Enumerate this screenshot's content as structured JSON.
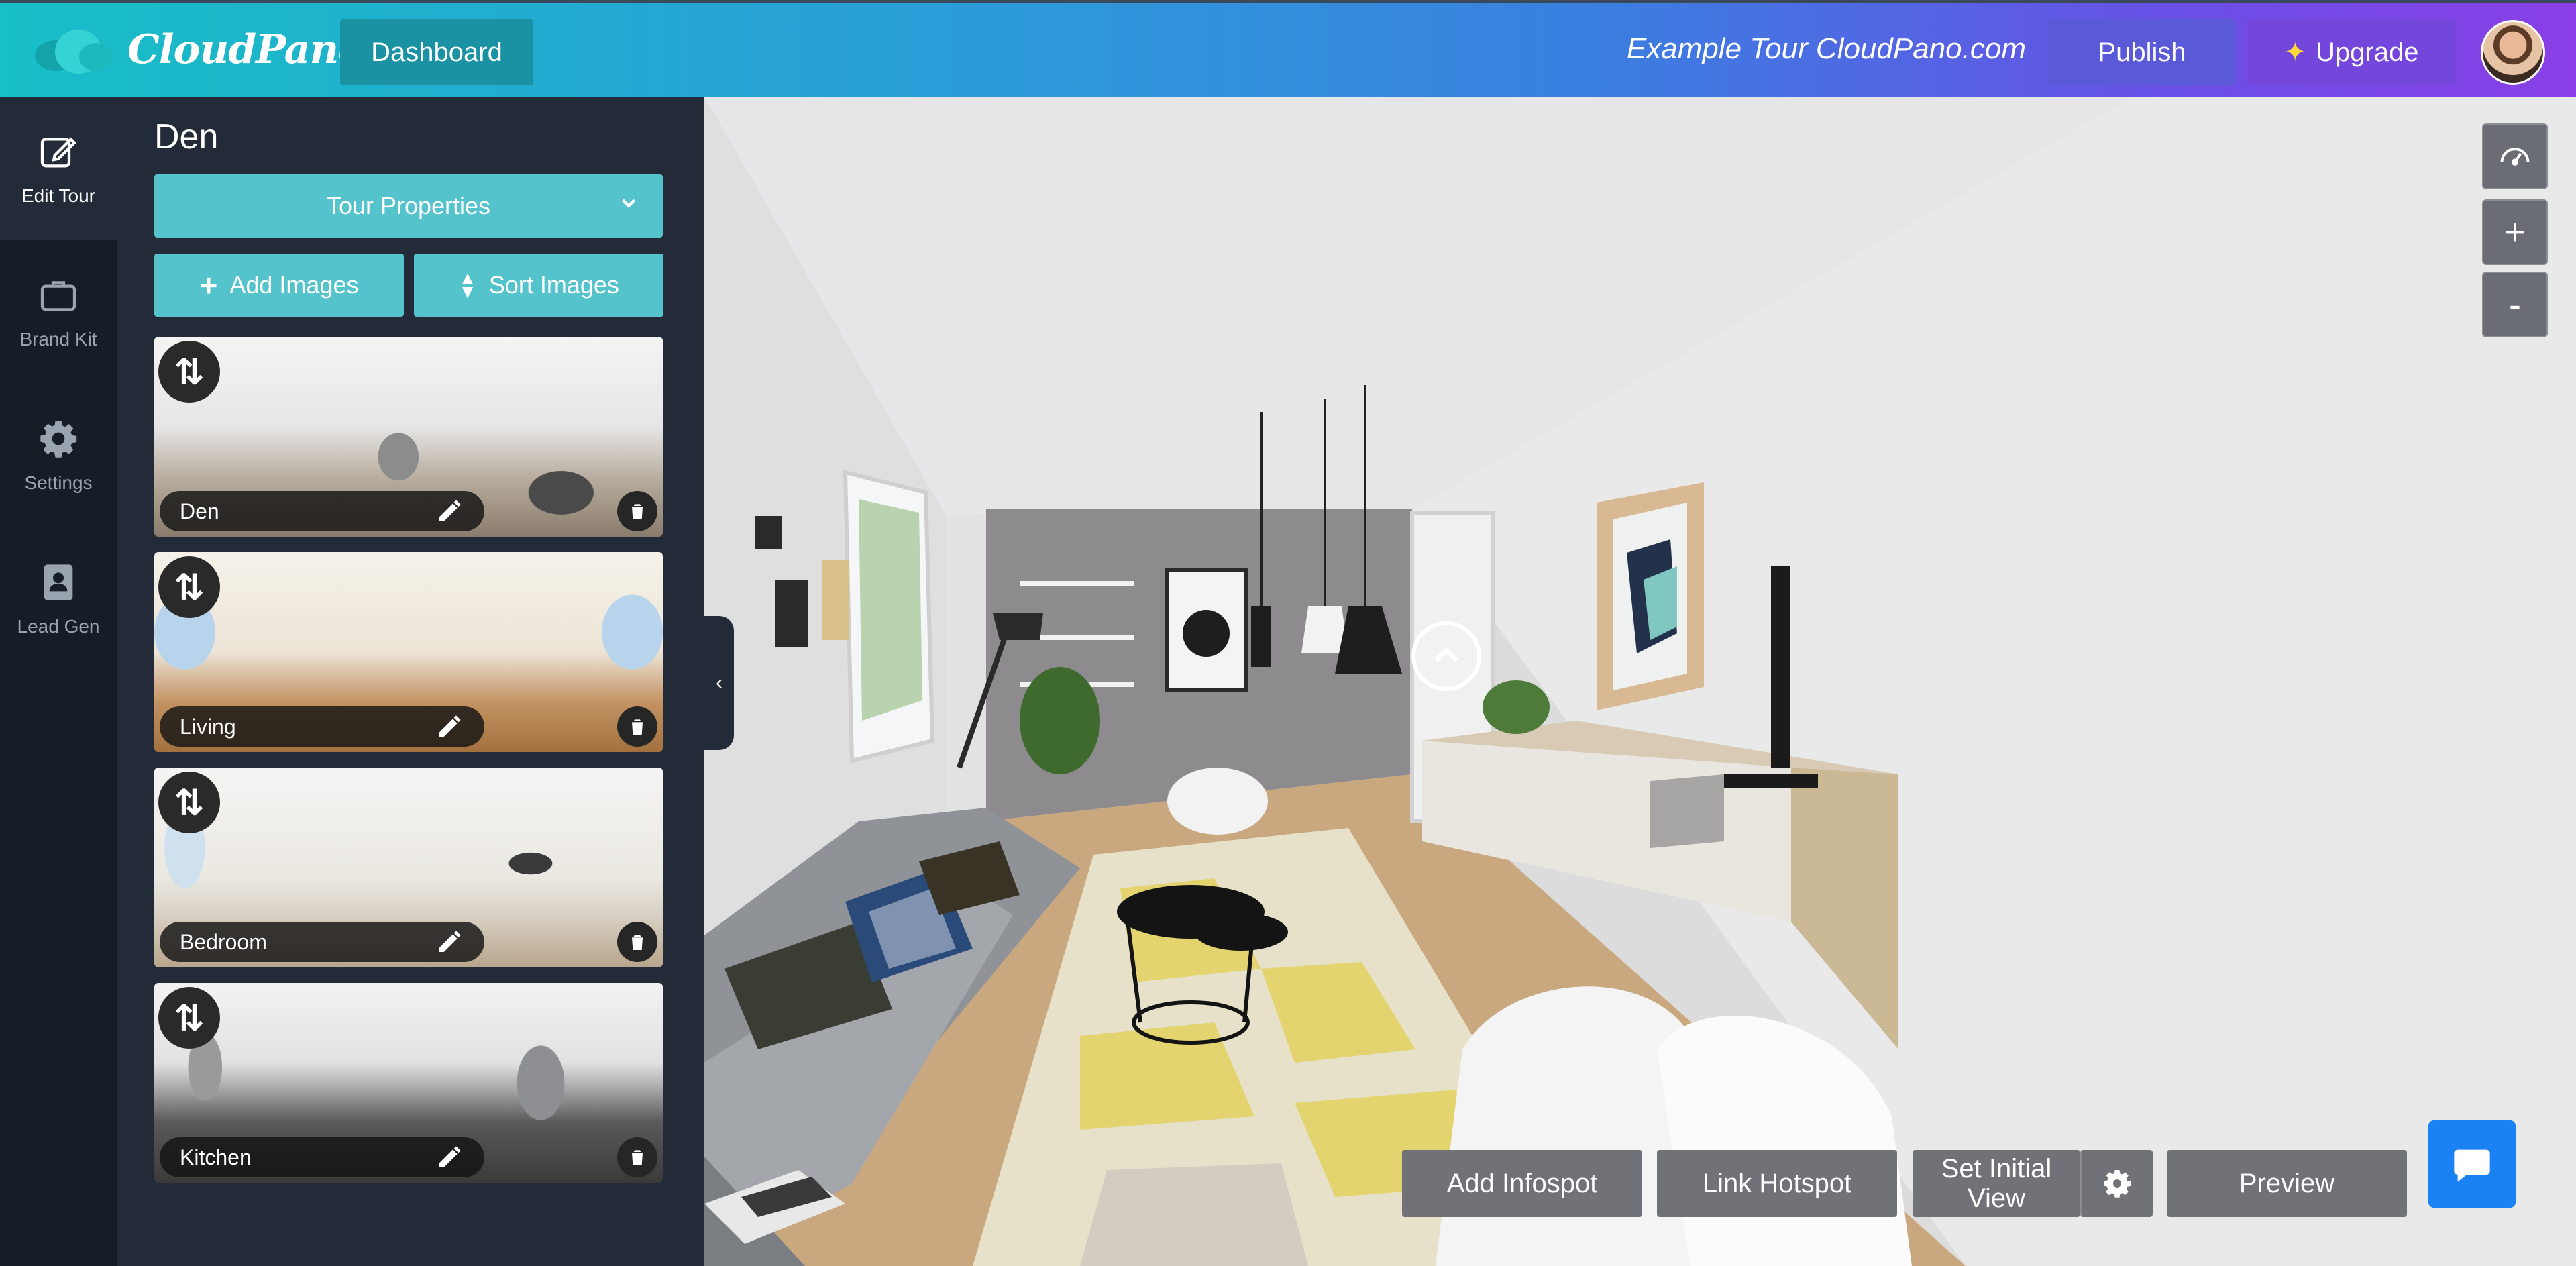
{
  "header": {
    "brand": "CloudPano",
    "dashboard_label": "Dashboard",
    "tour_name": "Example Tour CloudPano.com",
    "publish_label": "Publish",
    "upgrade_label": "Upgrade",
    "upgrade_icon": "sparkle-icon",
    "accent_colors": [
      "#17bfc6",
      "#3a7fe0",
      "#8a3fe6"
    ]
  },
  "rail": {
    "items": [
      {
        "label": "Edit Tour",
        "icon": "edit-icon",
        "active": true
      },
      {
        "label": "Brand Kit",
        "icon": "briefcase-icon",
        "active": false
      },
      {
        "label": "Settings",
        "icon": "gear-icon",
        "active": false
      },
      {
        "label": "Lead Gen",
        "icon": "contact-icon",
        "active": false
      }
    ]
  },
  "panel": {
    "current_scene": "Den",
    "tour_properties_label": "Tour Properties",
    "add_images_label": "Add Images",
    "sort_images_label": "Sort Images",
    "scenes": [
      {
        "name": "Den"
      },
      {
        "name": "Living"
      },
      {
        "name": "Bedroom"
      },
      {
        "name": "Kitchen"
      }
    ]
  },
  "viewer": {
    "controls": [
      "gauge-icon",
      "+",
      "-"
    ],
    "bottom_actions": {
      "add_infospot": "Add Infospot",
      "link_hotspot": "Link Hotspot",
      "set_initial_view": "Set Initial View",
      "preview": "Preview"
    },
    "chat_icon": "chat-icon",
    "accent_chat": "#1a82f2"
  }
}
